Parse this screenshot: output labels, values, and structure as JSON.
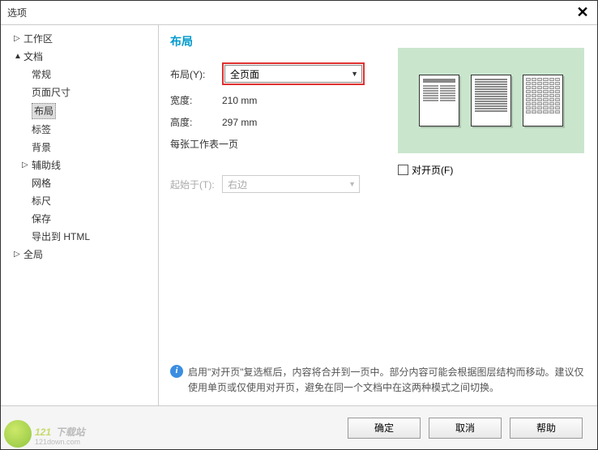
{
  "window": {
    "title": "选项"
  },
  "sidebar": {
    "items": [
      {
        "label": "工作区",
        "level": 1,
        "arrow": "▷"
      },
      {
        "label": "文档",
        "level": 1,
        "arrow": "▲"
      },
      {
        "label": "常规",
        "level": 2
      },
      {
        "label": "页面尺寸",
        "level": 2
      },
      {
        "label": "布局",
        "level": 2,
        "selected": true
      },
      {
        "label": "标签",
        "level": 2
      },
      {
        "label": "背景",
        "level": 2
      },
      {
        "label": "辅助线",
        "level": 2,
        "arrow": "▷"
      },
      {
        "label": "网格",
        "level": 2
      },
      {
        "label": "标尺",
        "level": 2
      },
      {
        "label": "保存",
        "level": 2
      },
      {
        "label": "导出到 HTML",
        "level": 2
      },
      {
        "label": "全局",
        "level": 1,
        "arrow": "▷"
      }
    ]
  },
  "content": {
    "title": "布局",
    "layout_label": "布局(Y):",
    "layout_value": "全页面",
    "width_label": "宽度:",
    "width_value": "210 mm",
    "height_label": "高度:",
    "height_value": "297 mm",
    "perpage_label": "每张工作表一页",
    "facing_label": "对开页(F)",
    "startat_label": "起始于(T):",
    "startat_value": "右边",
    "info_text": "启用\"对开页\"复选框后，内容将合并到一页中。部分内容可能会根据图层结构而移动。建议仅使用单页或仅使用对开页，避免在同一个文档中在这两种模式之间切换。"
  },
  "footer": {
    "ok": "确定",
    "cancel": "取消",
    "help": "帮助"
  },
  "watermark": {
    "brand": "下载站",
    "url": "121down.com"
  }
}
